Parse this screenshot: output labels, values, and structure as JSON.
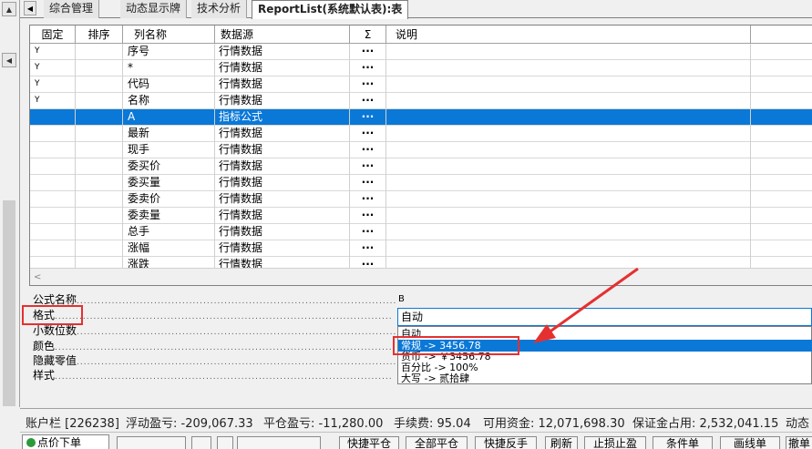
{
  "tabs": [
    {
      "label": "综合管理",
      "active": false
    },
    {
      "label": "动态显示牌",
      "active": false
    },
    {
      "label": "技术分析",
      "active": false
    },
    {
      "label": "ReportList(系统默认表):表",
      "active": true
    }
  ],
  "grid": {
    "headers": [
      "固定",
      "排序",
      "列名称",
      "数据源",
      "Σ",
      "说明"
    ],
    "rows": [
      {
        "fixed": "Y",
        "sort": "",
        "name": "序号",
        "source": "行情数据",
        "sum": "···",
        "desc": ""
      },
      {
        "fixed": "Y",
        "sort": "",
        "name": "*",
        "source": "行情数据",
        "sum": "···",
        "desc": ""
      },
      {
        "fixed": "Y",
        "sort": "",
        "name": "代码",
        "source": "行情数据",
        "sum": "···",
        "desc": ""
      },
      {
        "fixed": "Y",
        "sort": "",
        "name": "名称",
        "source": "行情数据",
        "sum": "···",
        "desc": ""
      },
      {
        "fixed": "",
        "sort": "",
        "name": "A",
        "source": "指标公式",
        "sum": "···",
        "desc": "",
        "selected": true
      },
      {
        "fixed": "",
        "sort": "",
        "name": "最新",
        "source": "行情数据",
        "sum": "···",
        "desc": ""
      },
      {
        "fixed": "",
        "sort": "",
        "name": "现手",
        "source": "行情数据",
        "sum": "···",
        "desc": ""
      },
      {
        "fixed": "",
        "sort": "",
        "name": "委买价",
        "source": "行情数据",
        "sum": "···",
        "desc": ""
      },
      {
        "fixed": "",
        "sort": "",
        "name": "委买量",
        "source": "行情数据",
        "sum": "···",
        "desc": ""
      },
      {
        "fixed": "",
        "sort": "",
        "name": "委卖价",
        "source": "行情数据",
        "sum": "···",
        "desc": ""
      },
      {
        "fixed": "",
        "sort": "",
        "name": "委卖量",
        "source": "行情数据",
        "sum": "···",
        "desc": ""
      },
      {
        "fixed": "",
        "sort": "",
        "name": "总手",
        "source": "行情数据",
        "sum": "···",
        "desc": ""
      },
      {
        "fixed": "",
        "sort": "",
        "name": "涨幅",
        "source": "行情数据",
        "sum": "···",
        "desc": ""
      },
      {
        "fixed": "",
        "sort": "",
        "name": "涨跌",
        "source": "行情数据",
        "sum": "···",
        "desc": ""
      }
    ]
  },
  "properties": {
    "formula_name_label": "公式名称",
    "formula_name_value": "B",
    "format_label": "格式",
    "decimals_label": "小数位数",
    "color_label": "颜色",
    "hide_zero_label": "隐藏零值",
    "style_label": "样式",
    "dots": "................................................................................................"
  },
  "format_combo": {
    "current": "自动",
    "options": [
      {
        "label": "自动"
      },
      {
        "label": "常规    ->   3456.78",
        "selected": true
      },
      {
        "label": "货币    ->   ￥3456.78"
      },
      {
        "label": "百分比  ->   100%"
      },
      {
        "label": "大写    ->   贰拾肆"
      }
    ]
  },
  "status": {
    "account": "账户栏 [226238]",
    "float_pl": "浮动盈亏: -209,067.33",
    "close_pl": "平仓盈亏: -11,280.00",
    "fee": "手续费: 95.04",
    "available": "可用资金: 12,071,698.30",
    "margin": "保证金占用: 2,532,041.15",
    "dynamic": "动态"
  },
  "bottom": {
    "order_tab": "点价下单",
    "buttons": [
      "快捷平仓",
      "全部平仓",
      "快捷反手",
      "刷新",
      "止损止盈",
      "条件单",
      "画线单",
      "撤单"
    ]
  },
  "colors": {
    "selection": "#0a78d7",
    "highlight_box": "#e53030",
    "order_dot": "#2c9a3a"
  }
}
